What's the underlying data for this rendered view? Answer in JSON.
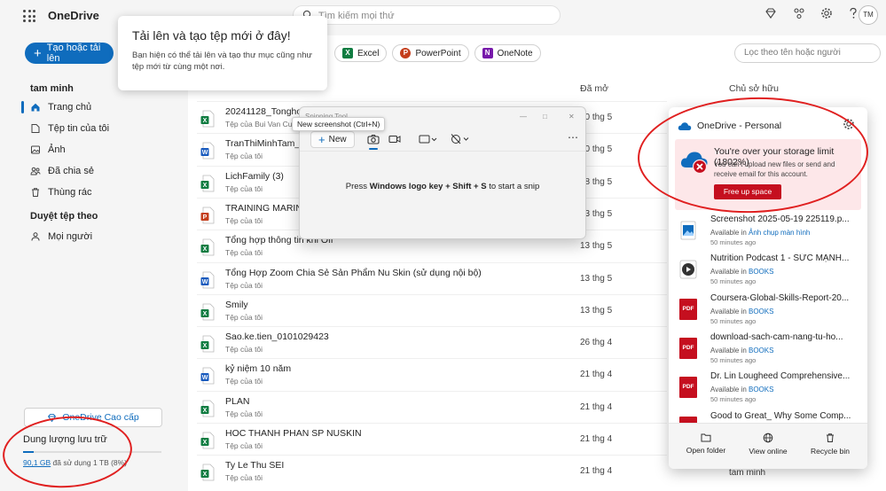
{
  "app": {
    "brand": "OneDrive",
    "avatar": "TM"
  },
  "search": {
    "placeholder": "Tìm kiếm mọi thứ"
  },
  "sidebar": {
    "create_label": "Tạo hoặc tải lên",
    "user": "tam minh",
    "items": [
      {
        "label": "Trang chủ",
        "icon": "home-icon",
        "active": true
      },
      {
        "label": "Tệp tin của tôi",
        "icon": "folder-icon"
      },
      {
        "label": "Ảnh",
        "icon": "photo-icon"
      },
      {
        "label": "Đã chia sẻ",
        "icon": "people-icon"
      },
      {
        "label": "Thùng rác",
        "icon": "trash-icon"
      }
    ],
    "browse_header": "Duyệt tệp theo",
    "people_label": "Mọi người",
    "premium_label": "OneDrive Cao cấp",
    "storage_title": "Dung lượng lưu trữ",
    "storage_used": "90,1 GB",
    "storage_rest": " đã sử dụng 1 TB (8%)",
    "storage_fraction": 0.08
  },
  "tooltip": {
    "title": "Tải lên và tạo tệp mới ở đây!",
    "text": "Bạn hiện có thể tải lên và tạo thư mục cũng như tệp mới từ cùng một nơi."
  },
  "pills": [
    {
      "label": "Excel",
      "letter": "X",
      "color": "#107c41"
    },
    {
      "label": "PowerPoint",
      "letter": "P",
      "color": "#c43e1c"
    },
    {
      "label": "OneNote",
      "letter": "N",
      "color": "#7719aa"
    }
  ],
  "filter": {
    "placeholder": "Lọc theo tên hoặc người"
  },
  "columns": {
    "opened": "Đã mở",
    "owner": "Chủ sở hữu"
  },
  "files": [
    {
      "name": "20241128_Tonghopti",
      "owner": "Tệp của Bui Van Cuon",
      "date": "20 thg 5",
      "type": "excel"
    },
    {
      "name": "TranThiMinhTam_W3",
      "owner": "Tệp của tôi",
      "date": "20 thg 5",
      "type": "word"
    },
    {
      "name": "LichFamily (3)",
      "owner": "Tệp của tôi",
      "date": "18 thg 5",
      "type": "excel"
    },
    {
      "name": "TRAINING MARINE C",
      "owner": "Tệp của tôi",
      "date": "13 thg 5",
      "type": "ppt"
    },
    {
      "name": "Tổng hợp thông tin khi Off",
      "owner": "Tệp của tôi",
      "date": "13 thg 5",
      "type": "excel"
    },
    {
      "name": "Tổng Hợp Zoom Chia Sẻ Sản Phẩm Nu Skin (sử dụng nội bộ)",
      "owner": "Tệp của tôi",
      "date": "13 thg 5",
      "type": "word"
    },
    {
      "name": "Smily",
      "owner": "Tệp của tôi",
      "date": "13 thg 5",
      "type": "excel"
    },
    {
      "name": "Sao.ke.tien_0101029423",
      "owner": "Tệp của tôi",
      "date": "26 thg 4",
      "type": "excel"
    },
    {
      "name": "kỷ niệm 10 năm",
      "owner": "Tệp của tôi",
      "date": "21 thg 4",
      "type": "word"
    },
    {
      "name": "PLAN",
      "owner": "Tệp của tôi",
      "date": "21 thg 4",
      "type": "excel"
    },
    {
      "name": "HOC THANH PHAN SP NUSKIN",
      "owner": "Tệp của tôi",
      "date": "21 thg 4",
      "type": "excel"
    },
    {
      "name": "Ty Le Thu SEI",
      "owner": "Tệp của tôi",
      "date": "21 thg 4",
      "type": "excel"
    }
  ],
  "owner_tail": "tam minh",
  "snip": {
    "title": "Snipping Tool",
    "new_label": "New",
    "tip": "New screenshot (Ctrl+N)",
    "body_pre": "Press ",
    "body_keys": "Windows logo key + Shift + S",
    "body_post": " to start a snip"
  },
  "flyout": {
    "title": "OneDrive - Personal",
    "alert_title": "You're over your storage limit (1802%)",
    "alert_text": "You can't upload new files or send and receive email for this account.",
    "alert_button": "Free up space",
    "items": [
      {
        "name": "Screenshot 2025-05-19 225119.p...",
        "loc_prefix": "Available in ",
        "loc": "Ảnh chụp màn hình",
        "time": "50 minutes ago",
        "icon": "image"
      },
      {
        "name": "Nutrition Podcast 1 - SỨC MẠNH...",
        "loc_prefix": "Available in ",
        "loc": "BOOKS",
        "time": "50 minutes ago",
        "icon": "media"
      },
      {
        "name": "Coursera-Global-Skills-Report-20...",
        "loc_prefix": "Available in ",
        "loc": "BOOKS",
        "time": "50 minutes ago",
        "icon": "pdf"
      },
      {
        "name": "download-sach-cam-nang-tu-ho...",
        "loc_prefix": "Available in ",
        "loc": "BOOKS",
        "time": "50 minutes ago",
        "icon": "pdf"
      },
      {
        "name": "Dr. Lin Lougheed Comprehensive...",
        "loc_prefix": "Available in ",
        "loc": "BOOKS",
        "time": "50 minutes ago",
        "icon": "pdf"
      },
      {
        "name": "Good to Great_ Why Some Comp...",
        "loc_prefix": "",
        "loc": "",
        "time": "",
        "icon": "pdf"
      }
    ],
    "footer": {
      "open_folder": "Open folder",
      "view_online": "View online",
      "recycle_bin": "Recycle bin"
    }
  },
  "colors": {
    "accent": "#0f6cbd",
    "alert_bg": "#fde7e9",
    "alert_button": "#c50f1f",
    "annotation": "#e02020"
  }
}
